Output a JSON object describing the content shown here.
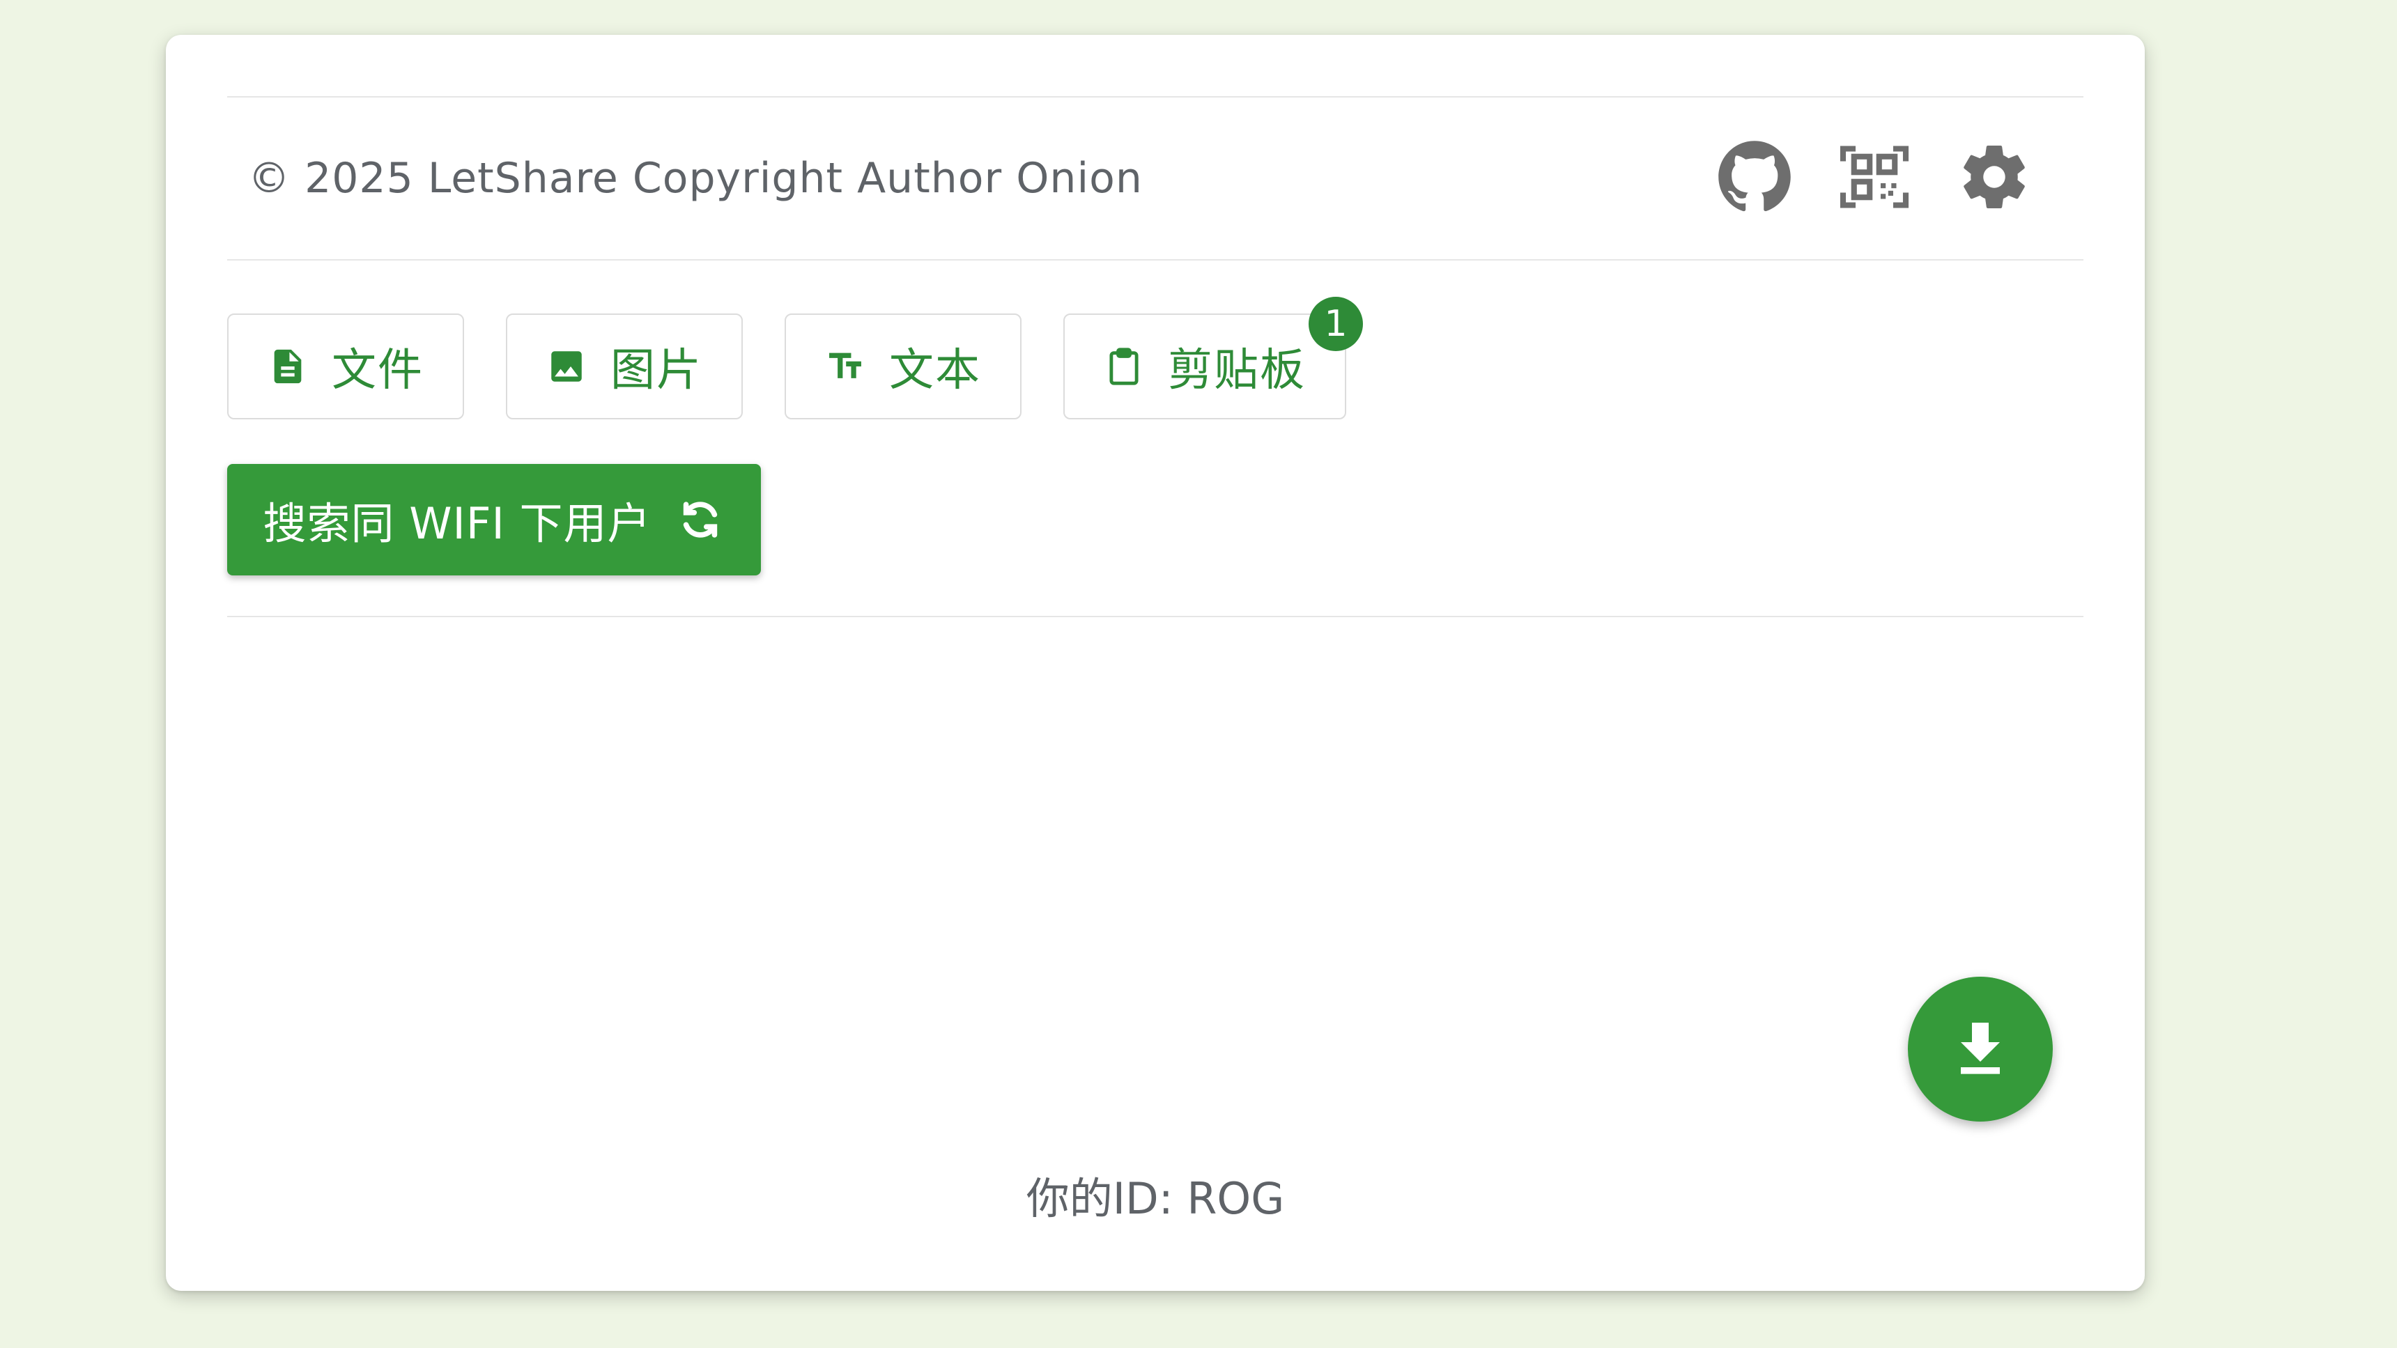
{
  "footer": {
    "copyright": "© 2025 LetShare Copyright Author Onion",
    "icons": [
      "github-icon",
      "qr-code-icon",
      "gear-icon"
    ]
  },
  "tabs": [
    {
      "label": "文件",
      "icon": "file-icon"
    },
    {
      "label": "图片",
      "icon": "image-icon"
    },
    {
      "label": "文本",
      "icon": "text-format-icon"
    },
    {
      "label": "剪贴板",
      "icon": "clipboard-icon",
      "badge": "1"
    }
  ],
  "search_button": {
    "label": "搜索同 WIFI 下用户",
    "icon": "refresh-icon"
  },
  "fab": {
    "icon": "download-icon"
  },
  "user": {
    "id_text": "你的ID: ROG"
  },
  "colors": {
    "accent": "#2e8b37",
    "button": "#359a3a",
    "background": "#eef5e4",
    "text_muted": "#5f6368"
  }
}
